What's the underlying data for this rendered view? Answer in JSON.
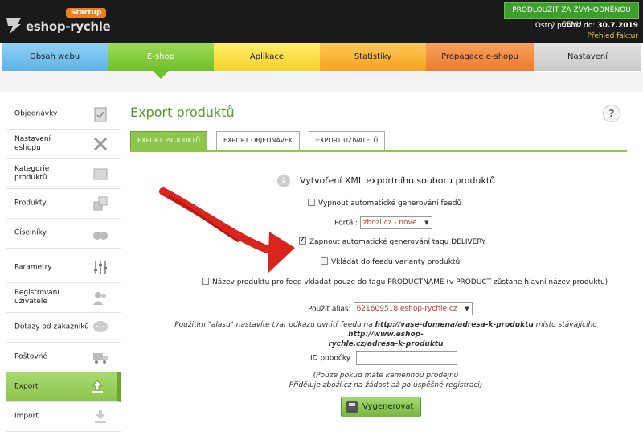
{
  "header": {
    "logo_text": "eshop-rychle",
    "logo_badge": "Startup",
    "upgrade_label": "PRODLOUŽIT ZA ZVÝHODNĚNOU CENU",
    "provoz_label": "Ostrý provoz do:",
    "provoz_date": "30.7.2019",
    "overview_link": "Přehled faktur"
  },
  "nav": {
    "tabs": [
      {
        "label": "Obsah webu"
      },
      {
        "label": "E-shop"
      },
      {
        "label": "Aplikace"
      },
      {
        "label": "Statistiky"
      },
      {
        "label": "Propagace e-shopu"
      },
      {
        "label": "Nastavení"
      }
    ],
    "active_tab": "E-shop"
  },
  "sidebar": {
    "items": [
      {
        "label": "Objednávky",
        "icon": "clipboard-icon"
      },
      {
        "label": "Nastavení\neshopu",
        "icon": "tools-icon"
      },
      {
        "label": "Kategorie\nproduktů",
        "icon": "folder-icon"
      },
      {
        "label": "Produkty",
        "icon": "boxes-icon"
      },
      {
        "label": "Číselníky",
        "icon": "binoculars-icon"
      },
      {
        "label": "Parametry",
        "icon": "sliders-icon"
      },
      {
        "label": "Registrovaní\nuživatelé",
        "icon": "users-icon"
      },
      {
        "label": "Dotazy od zákazníků",
        "icon": "chat-icon"
      },
      {
        "label": "Poštovné",
        "icon": "truck-icon"
      },
      {
        "label": "Export",
        "icon": "upload-icon"
      },
      {
        "label": "Import",
        "icon": "download-icon"
      }
    ],
    "active_item": "Export"
  },
  "main": {
    "title": "Export produktů",
    "help": "?",
    "subtabs": [
      {
        "label": "EXPORT PRODUKTŮ"
      },
      {
        "label": "EXPORT OBJEDNÁVEK"
      },
      {
        "label": "EXPORT UŽIVATELŮ"
      }
    ],
    "section_title": "Vytvoření XML exportního souboru produktů",
    "disable_auto": "Vypnout automatické generování feedů",
    "portal_label": "Portál:",
    "portal_value": "zbozi.cz - nove",
    "delivery_label": "Zapnout automatické generování tagu DELIVERY",
    "variants_label": "Vkládát do feedu varianty produktů",
    "productname_label": "Název produktu pro feed vkládat pouze do tagu PRODUCTNAME (v PRODUCT zůstane hlavní název produktu)",
    "alias_label": "Použít alias:",
    "alias_value": "621609518.eshop-rychle.cz",
    "note_line1a": "Použitím \"alasu\" nastavíte tvar odkazu uvnitř feedu na",
    "note_line1b": "http://vase-domena/adresa-k-produktu",
    "note_line1c": "místo stávajícího",
    "note_line1d": "http://www.eshop-",
    "note_line2": "rychle.cz/adresa-k-produktu",
    "id_label": "ID pobočky",
    "id_value": "",
    "id_note_1": "(Pouze pokud máte kamennou prodejnu",
    "id_note_2": "Přiděluje zboží.cz na žádost až po úspěšné registraci)",
    "generate_label": "Vygenerovat"
  },
  "colors": {
    "accent_green": "#8cc64a",
    "title_green": "#5a9a2a",
    "arrow_red": "#d9251d"
  }
}
